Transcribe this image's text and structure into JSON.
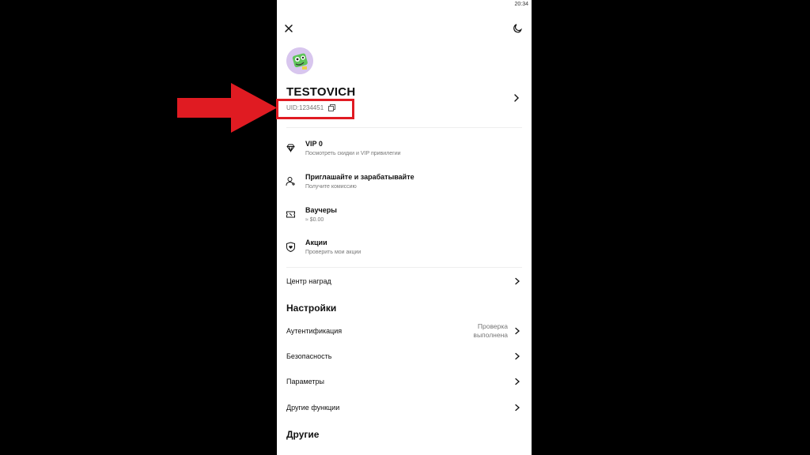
{
  "status_bar": {
    "time": "20:34"
  },
  "profile": {
    "username": "TESTOVICH",
    "uid": "UID:1234451"
  },
  "menu": [
    {
      "title": "VIP 0",
      "subtitle": "Посмотреть скидки и VIP привилегии",
      "icon": "diamond-icon"
    },
    {
      "title": "Приглашайте и зарабатывайте",
      "subtitle": "Получите комиссию",
      "icon": "add-user-icon"
    },
    {
      "title": "Ваучеры",
      "subtitle": "≈ $0.00",
      "icon": "ticket-icon"
    },
    {
      "title": "Акции",
      "subtitle": "Проверить мои акции",
      "icon": "shield-heart-icon"
    }
  ],
  "rewards_center": {
    "label": "Центр наград"
  },
  "settings": {
    "title": "Настройки",
    "items": [
      {
        "label": "Аутентификация",
        "status_line1": "Проверка",
        "status_line2": "выполнена"
      },
      {
        "label": "Безопасность"
      },
      {
        "label": "Параметры"
      },
      {
        "label": "Другие функции"
      }
    ]
  },
  "other": {
    "title": "Другие"
  },
  "colors": {
    "annotation": "#e01b22",
    "background": "#000000",
    "panel": "#ffffff"
  }
}
